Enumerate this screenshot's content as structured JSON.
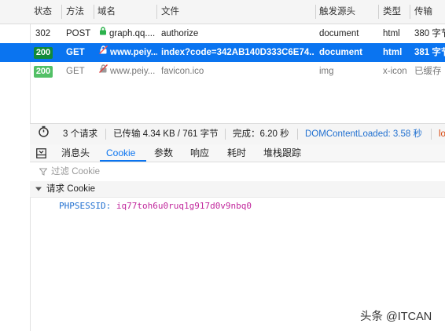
{
  "columns": {
    "status": "状态",
    "method": "方法",
    "domain": "域名",
    "file": "文件",
    "cause": "触发源头",
    "type": "类型",
    "transferred": "传输"
  },
  "requests": [
    {
      "status": "302",
      "method": "POST",
      "domain": "graph.qq....",
      "file": "authorize",
      "cause": "document",
      "type": "html",
      "transferred": "380 字节"
    },
    {
      "status": "200",
      "method": "GET",
      "domain": "www.peiy...",
      "file": "index?code=342AB140D333C6E74...",
      "cause": "document",
      "type": "html",
      "transferred": "381 字节"
    },
    {
      "status": "200",
      "method": "GET",
      "domain": "www.peiy...",
      "file": "favicon.ico",
      "cause": "img",
      "type": "x-icon",
      "transferred": "已缓存"
    }
  ],
  "statusbar": {
    "requests": "3 个请求",
    "transferred": "已传输 4.34 KB / 761 字节",
    "finish": "完成：6.20 秒",
    "dcl": "DOMContentLoaded: 3.58 秒",
    "load": "lo"
  },
  "tabs": [
    "消息头",
    "Cookie",
    "参数",
    "响应",
    "耗时",
    "堆栈跟踪"
  ],
  "active_tab": "Cookie",
  "filter_placeholder": "过滤 Cookie",
  "section_title": "请求 Cookie",
  "cookie": {
    "name": "PHPSESSID",
    "sep": ": ",
    "value": "iq77toh6u0ruq1g917d0v9nbq0"
  },
  "watermark": "头条 @ITCAN",
  "colors": {
    "selected_row": "#0a74f0",
    "status_ok": "#2bb24c",
    "link_blue": "#1f6fd0",
    "cookie_value": "#c1279c"
  }
}
